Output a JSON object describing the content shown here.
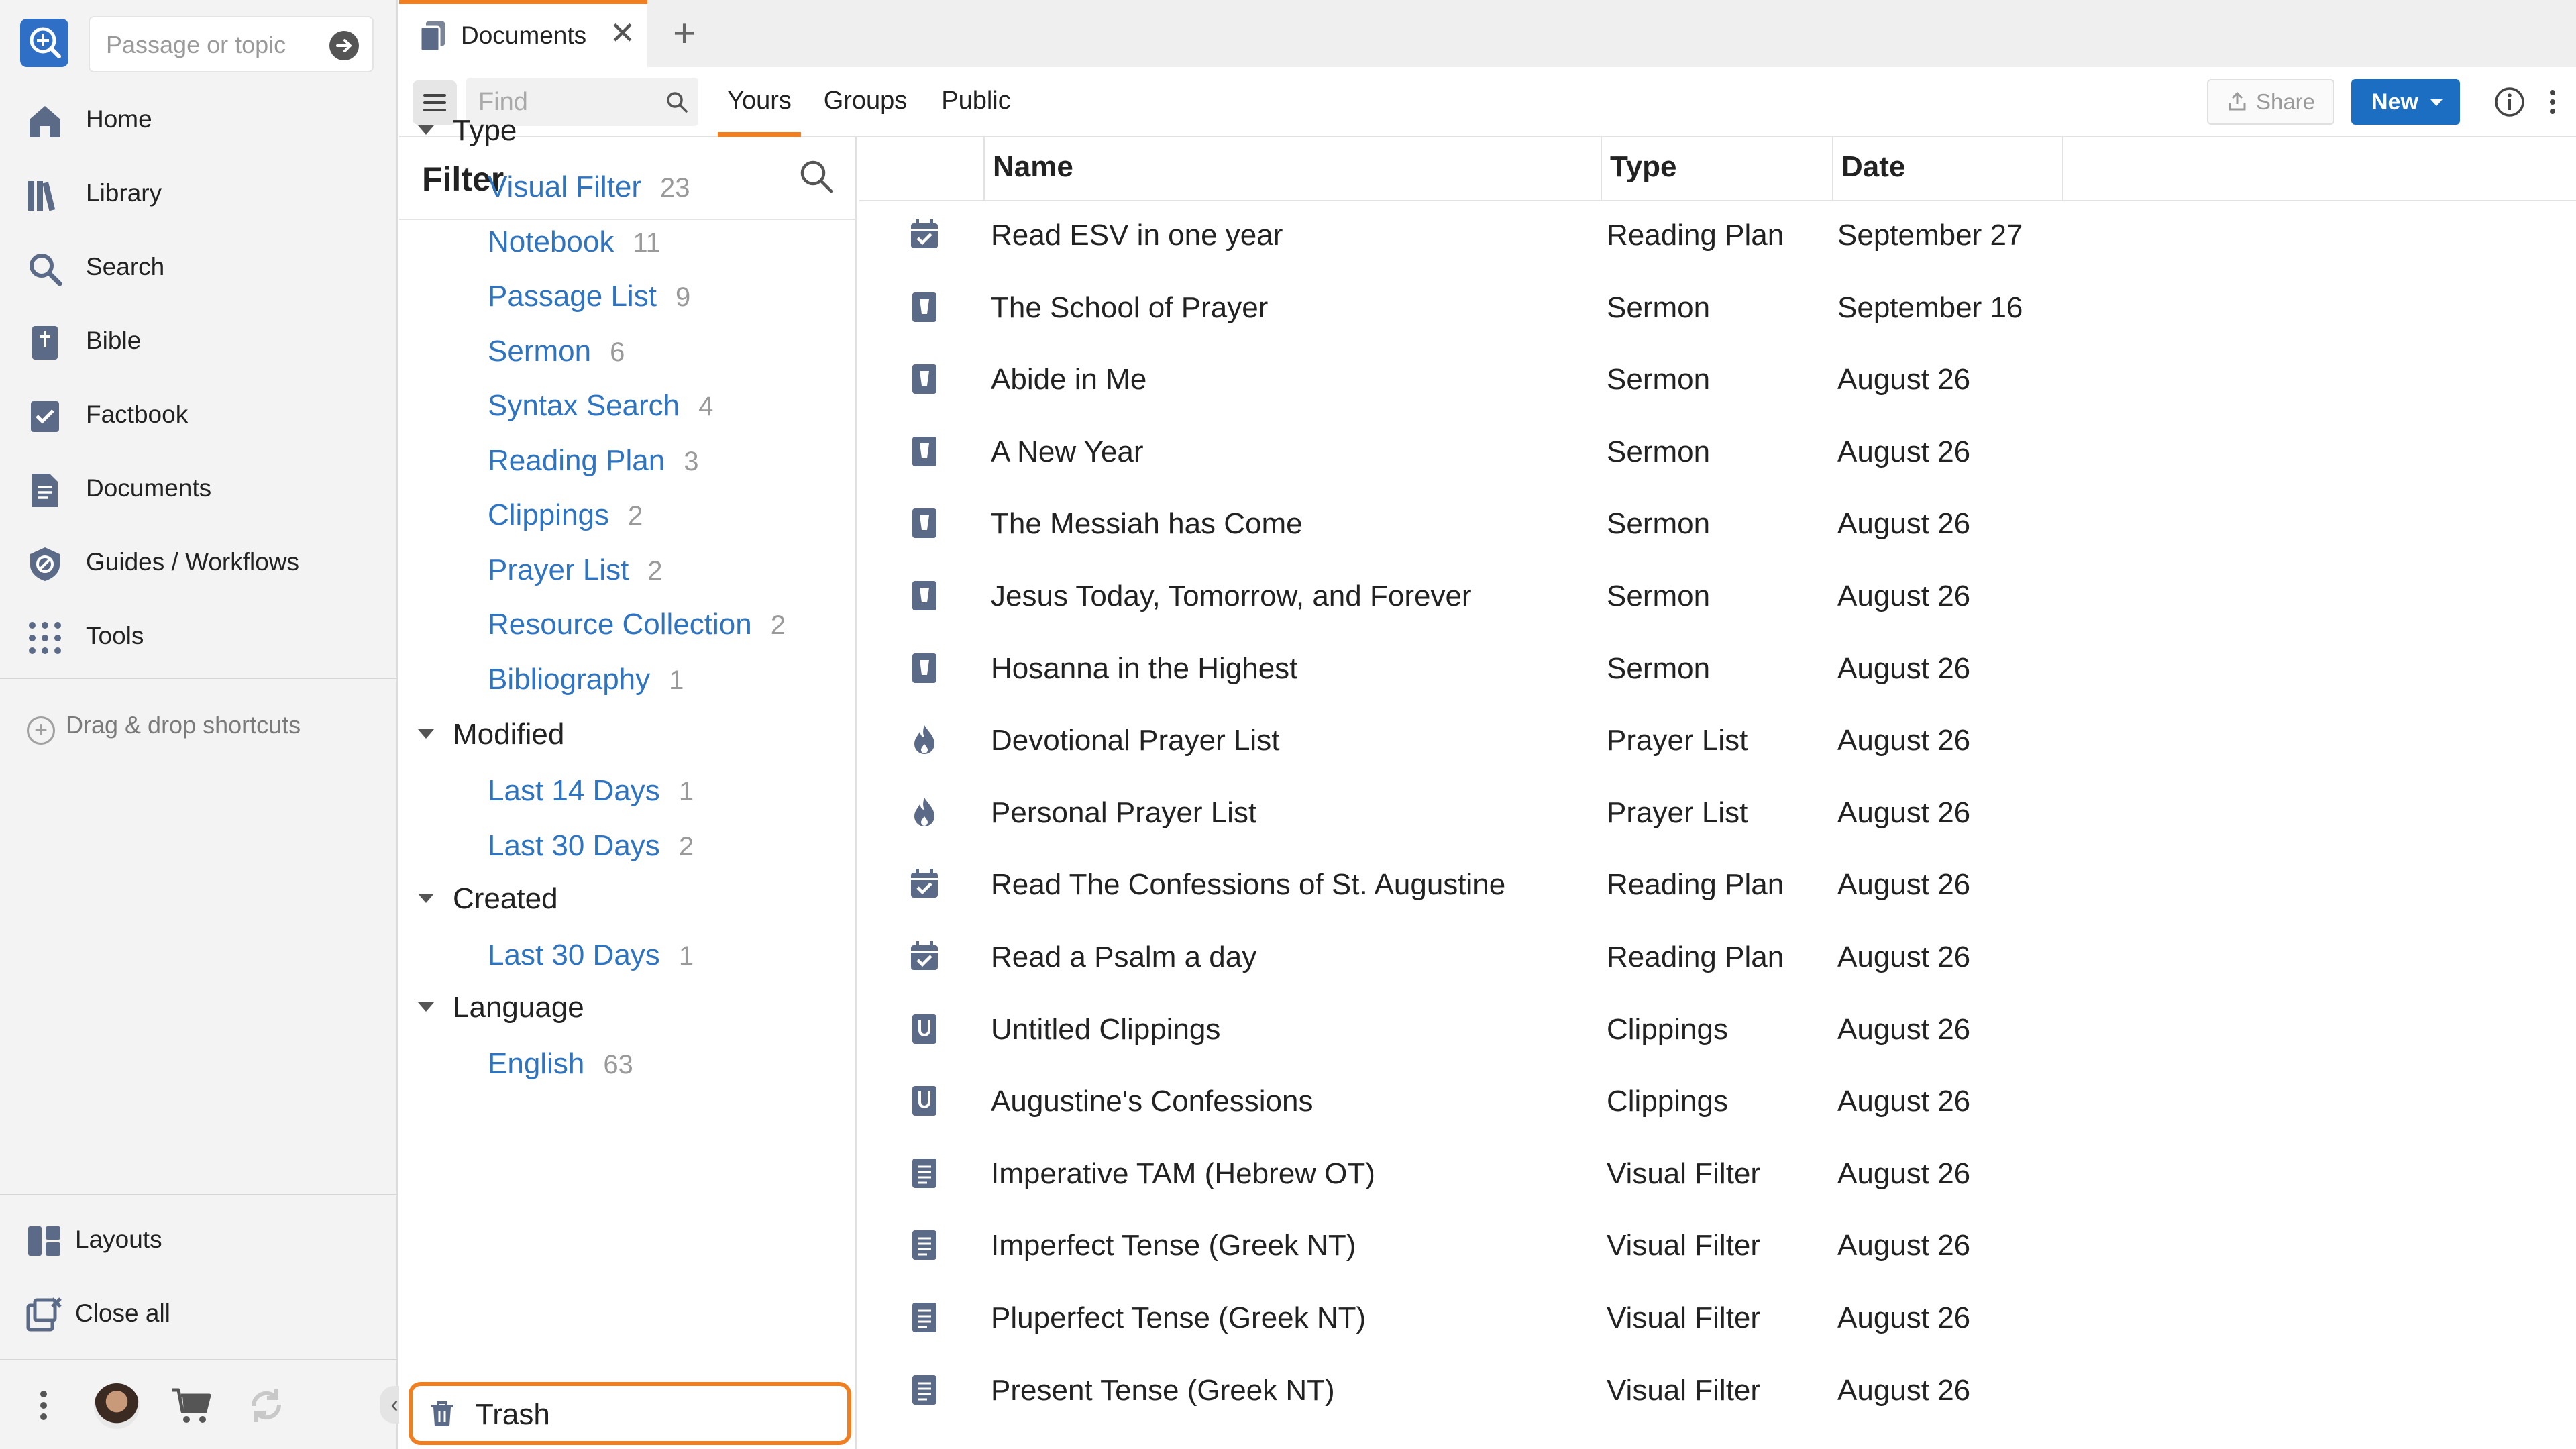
{
  "sidebar": {
    "logo_icon": "logos-search-logo-icon",
    "passage_placeholder": "Passage or topic",
    "nav": [
      {
        "label": "Home",
        "icon": "home-icon"
      },
      {
        "label": "Library",
        "icon": "library-icon"
      },
      {
        "label": "Search",
        "icon": "search-icon"
      },
      {
        "label": "Bible",
        "icon": "bible-icon"
      },
      {
        "label": "Factbook",
        "icon": "factbook-icon"
      },
      {
        "label": "Documents",
        "icon": "documents-icon"
      },
      {
        "label": "Guides / Workflows",
        "icon": "guides-icon"
      },
      {
        "label": "Tools",
        "icon": "tools-grid-icon"
      }
    ],
    "drag_hint": "Drag & drop shortcuts",
    "layouts_label": "Layouts",
    "close_all_label": "Close all"
  },
  "tabstrip": {
    "active_tab": "Documents"
  },
  "toolbar": {
    "find_placeholder": "Find",
    "tabs": [
      "Yours",
      "Groups",
      "Public"
    ],
    "active_tab": "Yours",
    "share_label": "Share",
    "new_label": "New"
  },
  "filter": {
    "title": "Filter",
    "groups": [
      {
        "label": "Type",
        "items": [
          {
            "label": "Visual Filter",
            "count": "23"
          },
          {
            "label": "Notebook",
            "count": "11"
          },
          {
            "label": "Passage List",
            "count": "9"
          },
          {
            "label": "Sermon",
            "count": "6"
          },
          {
            "label": "Syntax Search",
            "count": "4"
          },
          {
            "label": "Reading Plan",
            "count": "3"
          },
          {
            "label": "Clippings",
            "count": "2"
          },
          {
            "label": "Prayer List",
            "count": "2"
          },
          {
            "label": "Resource Collection",
            "count": "2"
          },
          {
            "label": "Bibliography",
            "count": "1"
          }
        ]
      },
      {
        "label": "Modified",
        "items": [
          {
            "label": "Last 14 Days",
            "count": "1"
          },
          {
            "label": "Last 30 Days",
            "count": "2"
          }
        ]
      },
      {
        "label": "Created",
        "items": [
          {
            "label": "Last 30 Days",
            "count": "1"
          }
        ]
      },
      {
        "label": "Language",
        "items": [
          {
            "label": "English",
            "count": "63"
          }
        ]
      }
    ],
    "trash_label": "Trash"
  },
  "table": {
    "columns": [
      "Name",
      "Type",
      "Date"
    ],
    "rows": [
      {
        "icon": "reading-plan-icon",
        "name": "Read ESV in one year",
        "type": "Reading Plan",
        "date": "September 27"
      },
      {
        "icon": "sermon-icon",
        "name": "The School of Prayer",
        "type": "Sermon",
        "date": "September 16"
      },
      {
        "icon": "sermon-icon",
        "name": "Abide in Me",
        "type": "Sermon",
        "date": "August 26"
      },
      {
        "icon": "sermon-icon",
        "name": "A New Year",
        "type": "Sermon",
        "date": "August 26"
      },
      {
        "icon": "sermon-icon",
        "name": "The Messiah has Come",
        "type": "Sermon",
        "date": "August 26"
      },
      {
        "icon": "sermon-icon",
        "name": "Jesus Today, Tomorrow, and Forever",
        "type": "Sermon",
        "date": "August 26"
      },
      {
        "icon": "sermon-icon",
        "name": "Hosanna in the Highest",
        "type": "Sermon",
        "date": "August 26"
      },
      {
        "icon": "prayer-list-icon",
        "name": "Devotional Prayer List",
        "type": "Prayer List",
        "date": "August 26"
      },
      {
        "icon": "prayer-list-icon",
        "name": "Personal Prayer List",
        "type": "Prayer List",
        "date": "August 26"
      },
      {
        "icon": "reading-plan-icon",
        "name": "Read The Confessions of St. Augustine",
        "type": "Reading Plan",
        "date": "August 26"
      },
      {
        "icon": "reading-plan-icon",
        "name": "Read a Psalm a day",
        "type": "Reading Plan",
        "date": "August 26"
      },
      {
        "icon": "clippings-icon",
        "name": "Untitled Clippings",
        "type": "Clippings",
        "date": "August 26"
      },
      {
        "icon": "clippings-icon",
        "name": "Augustine's Confessions",
        "type": "Clippings",
        "date": "August 26"
      },
      {
        "icon": "visual-filter-icon",
        "name": "Imperative TAM (Hebrew OT)",
        "type": "Visual Filter",
        "date": "August 26"
      },
      {
        "icon": "visual-filter-icon",
        "name": "Imperfect Tense (Greek NT)",
        "type": "Visual Filter",
        "date": "August 26"
      },
      {
        "icon": "visual-filter-icon",
        "name": "Pluperfect Tense (Greek NT)",
        "type": "Visual Filter",
        "date": "August 26"
      },
      {
        "icon": "visual-filter-icon",
        "name": "Present Tense (Greek NT)",
        "type": "Visual Filter",
        "date": "August 26"
      }
    ]
  },
  "colors": {
    "accent": "#f07f22",
    "link": "#2f74c0",
    "primary_button": "#1b6ec2",
    "icon": "#5b6a86"
  }
}
